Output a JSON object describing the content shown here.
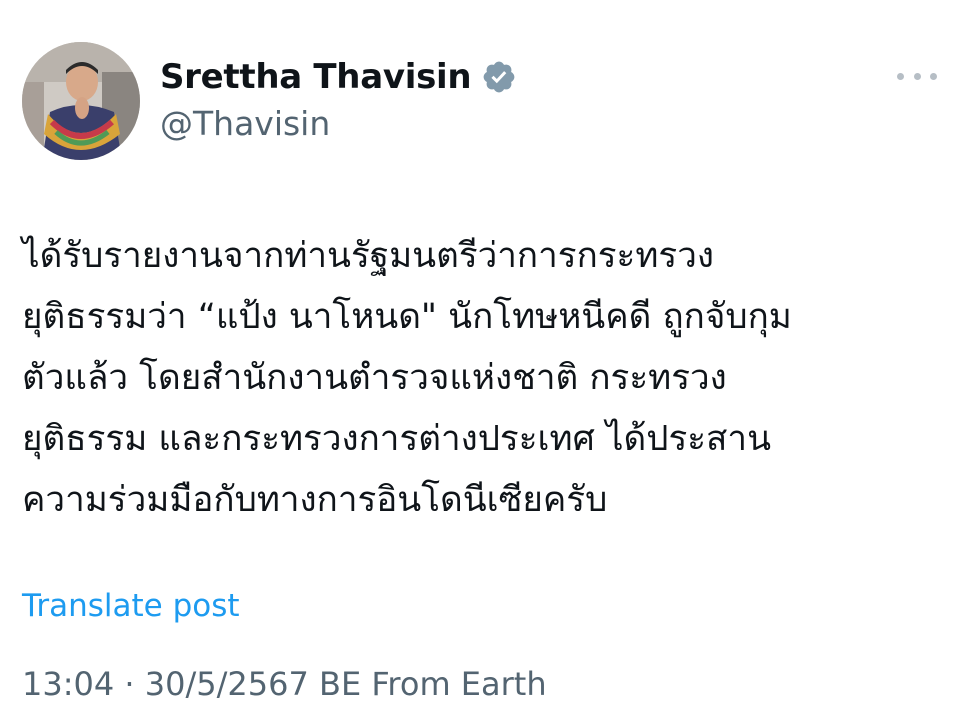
{
  "author": {
    "display_name": "Srettha Thavisin",
    "handle": "@Thavisin",
    "verified": true,
    "avatar_icon": "profile-photo"
  },
  "post": {
    "lines": [
      "ได้รับรายงานจากท่านรัฐมนตรีว่าการกระทรวง",
      "ยุติธรรมว่า “แป้ง นาโหนด\" นักโทษหนีคดี ถูกจับกุม",
      "ตัวแล้ว โดยสำนักงานตำรวจแห่งชาติ กระทรวง",
      "ยุติธรรม และกระทรวงการต่างประเทศ ได้ประสาน",
      "ความร่วมมือกับทางการอินโดนีเซียครับ"
    ],
    "translate_label": "Translate post",
    "meta": "13:04 · 30/5/2567 BE From Earth"
  },
  "colors": {
    "text": "#0f1419",
    "secondary": "#536471",
    "link": "#1d9bf0",
    "verified_badge": "#829aab"
  },
  "icons": {
    "verified": "verified-badge-icon",
    "more": "more-options-icon"
  }
}
